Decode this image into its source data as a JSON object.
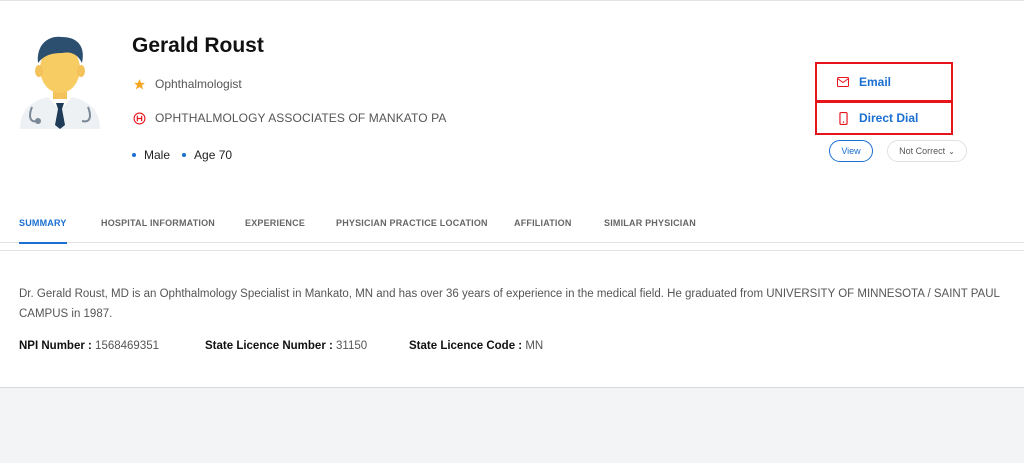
{
  "profile": {
    "name": "Gerald Roust",
    "specialty": "Ophthalmologist",
    "organization": "OPHTHALMOLOGY ASSOCIATES OF MANKATO PA",
    "gender": "Male",
    "age": "Age 70"
  },
  "contact": {
    "email_label": "Email",
    "direct_dial_label": "Direct Dial",
    "view_label": "View",
    "not_correct_label": "Not Correct"
  },
  "tabs": [
    {
      "label": "SUMMARY"
    },
    {
      "label": "HOSPITAL INFORMATION"
    },
    {
      "label": "EXPERIENCE"
    },
    {
      "label": "PHYSICIAN PRACTICE LOCATION"
    },
    {
      "label": "AFFILIATION"
    },
    {
      "label": "SIMILAR PHYSICIAN"
    }
  ],
  "summary": {
    "text": "Dr. Gerald Roust, MD is an Ophthalmology Specialist in Mankato, MN and has over 36 years of experience in the medical field. He graduated from UNIVERSITY OF MINNESOTA / SAINT PAUL CAMPUS in 1987.",
    "npi_label": "NPI Number :",
    "npi_value": "1568469351",
    "licence_number_label": "State Licence Number :",
    "licence_number_value": "31150",
    "licence_code_label": "State Licence Code :",
    "licence_code_value": "MN"
  },
  "icons": {
    "specialty": "star-icon",
    "organization": "hospital-icon",
    "email": "mail-icon",
    "direct_dial": "phone-icon"
  },
  "colors": {
    "accent": "#1a6fd1",
    "highlight_border": "#e8141c",
    "star": "#f5a623",
    "hospital": "#e8141c"
  }
}
